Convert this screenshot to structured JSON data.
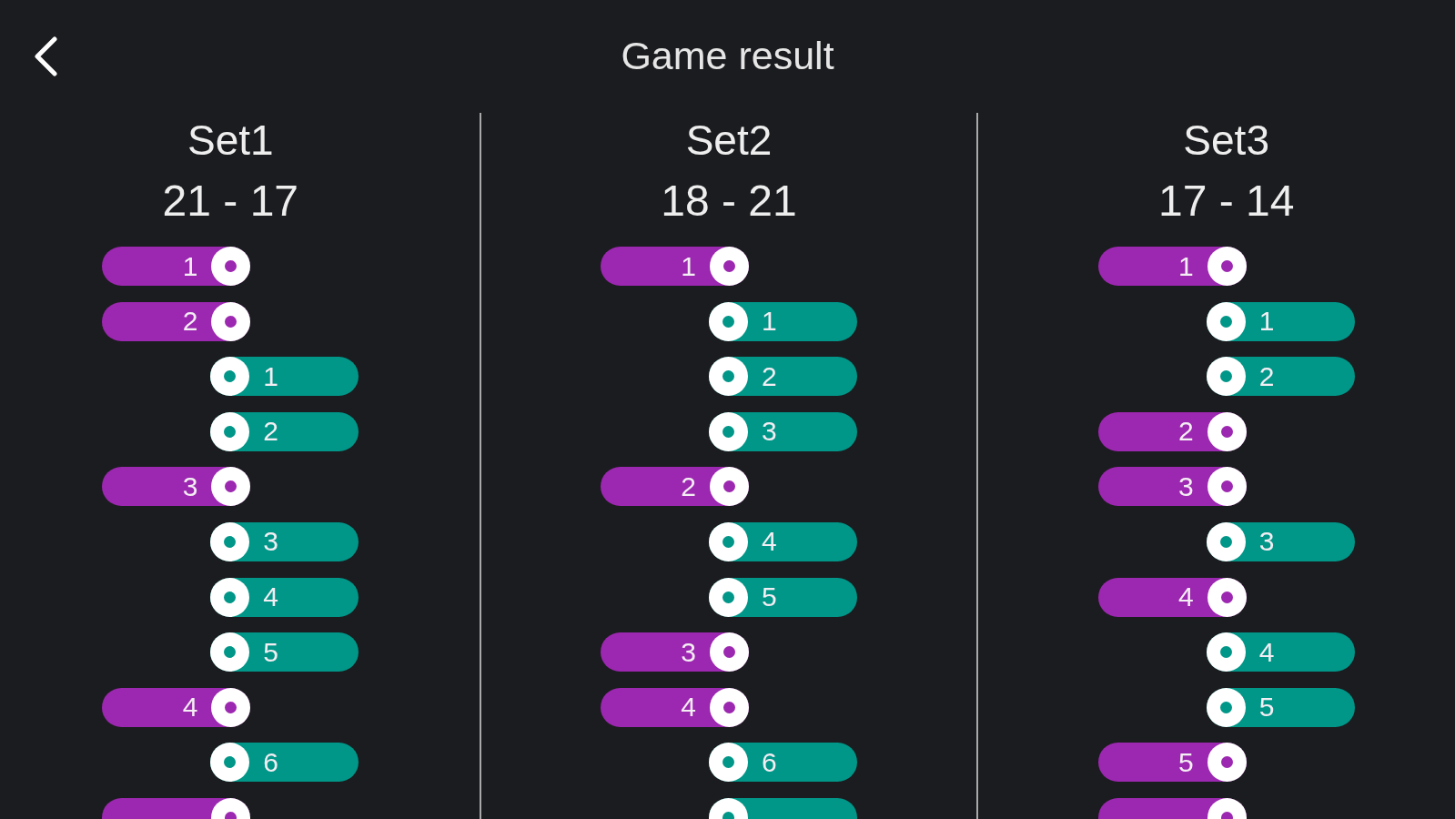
{
  "header": {
    "title": "Game result"
  },
  "sets": [
    {
      "name": "Set1",
      "score": "21 - 17",
      "points": [
        {
          "kind": "left",
          "color": "#9c27b0",
          "label": "1"
        },
        {
          "kind": "left",
          "color": "#9c27b0",
          "label": "2"
        },
        {
          "kind": "right",
          "color": "#009688",
          "label": "1"
        },
        {
          "kind": "right",
          "color": "#009688",
          "label": "2"
        },
        {
          "kind": "left",
          "color": "#9c27b0",
          "label": "3"
        },
        {
          "kind": "right",
          "color": "#009688",
          "label": "3"
        },
        {
          "kind": "right",
          "color": "#009688",
          "label": "4"
        },
        {
          "kind": "right",
          "color": "#009688",
          "label": "5"
        },
        {
          "kind": "left",
          "color": "#9c27b0",
          "label": "4"
        },
        {
          "kind": "right",
          "color": "#009688",
          "label": "6"
        },
        {
          "kind": "left",
          "color": "#9c27b0"
        }
      ]
    },
    {
      "name": "Set2",
      "score": "18 - 21",
      "points": [
        {
          "kind": "left",
          "color": "#9c27b0",
          "label": "1"
        },
        {
          "kind": "right",
          "color": "#009688",
          "label": "1"
        },
        {
          "kind": "right",
          "color": "#009688",
          "label": "2"
        },
        {
          "kind": "right",
          "color": "#009688",
          "label": "3"
        },
        {
          "kind": "left",
          "color": "#9c27b0",
          "label": "2"
        },
        {
          "kind": "right",
          "color": "#009688",
          "label": "4"
        },
        {
          "kind": "right",
          "color": "#009688",
          "label": "5"
        },
        {
          "kind": "left",
          "color": "#9c27b0",
          "label": "3"
        },
        {
          "kind": "left",
          "color": "#9c27b0",
          "label": "4"
        },
        {
          "kind": "right",
          "color": "#009688",
          "label": "6"
        },
        {
          "kind": "right",
          "color": "#009688"
        }
      ]
    },
    {
      "name": "Set3",
      "score": "17 - 14",
      "points": [
        {
          "kind": "left",
          "color": "#9c27b0",
          "label": "1"
        },
        {
          "kind": "right",
          "color": "#009688",
          "label": "1"
        },
        {
          "kind": "right",
          "color": "#009688",
          "label": "2"
        },
        {
          "kind": "left",
          "color": "#9c27b0",
          "label": "2"
        },
        {
          "kind": "left",
          "color": "#9c27b0",
          "label": "3"
        },
        {
          "kind": "right",
          "color": "#009688",
          "label": "3"
        },
        {
          "kind": "left",
          "color": "#9c27b0",
          "label": "4"
        },
        {
          "kind": "right",
          "color": "#009688",
          "label": "4"
        },
        {
          "kind": "right",
          "color": "#009688",
          "label": "5"
        },
        {
          "kind": "left",
          "color": "#9c27b0",
          "label": "5"
        },
        {
          "kind": "left",
          "color": "#9c27b0"
        }
      ]
    }
  ]
}
